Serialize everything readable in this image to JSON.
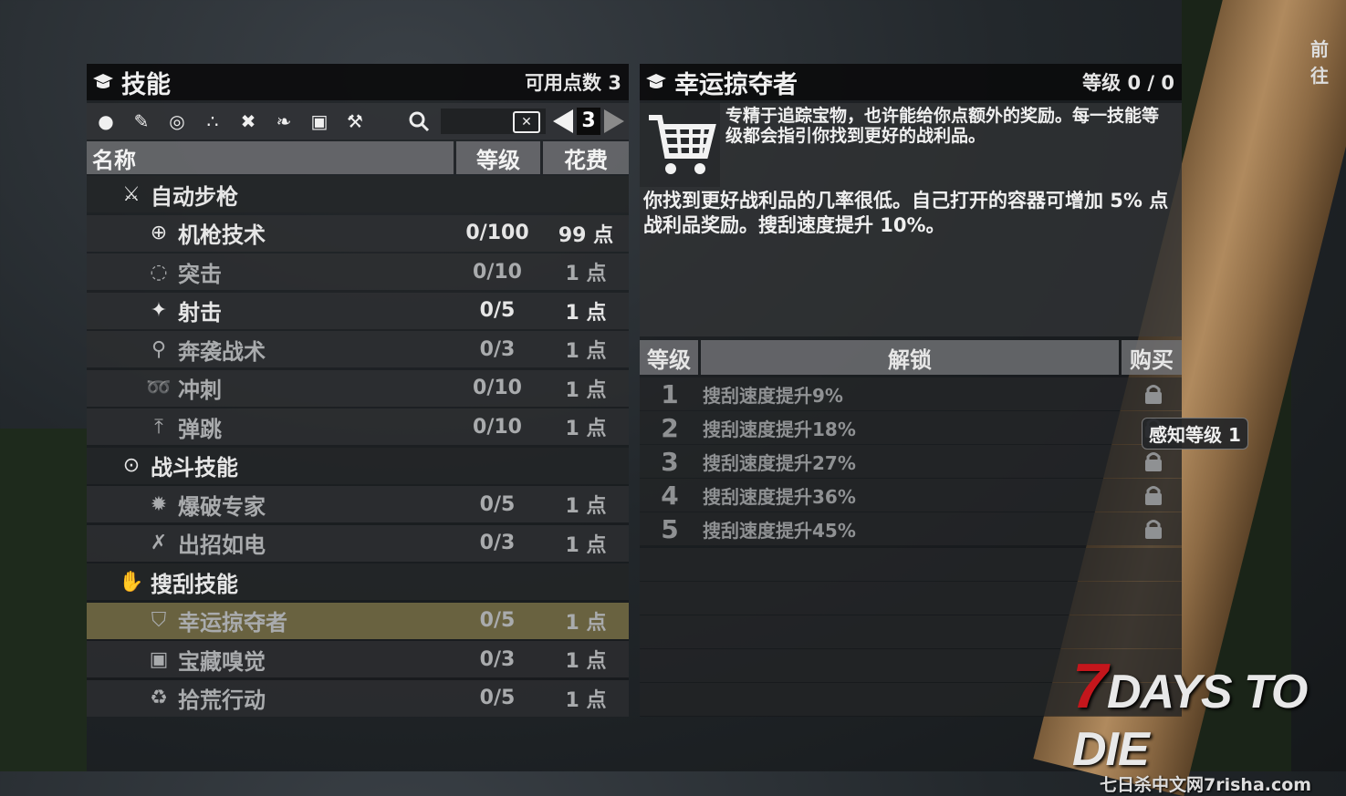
{
  "left_panel": {
    "title": "技能",
    "points_label": "可用点数 3"
  },
  "toolbar": {
    "page": "3",
    "icons": [
      "person-icon",
      "pen-icon",
      "target-icon",
      "stars-icon",
      "tools-icon",
      "feather-icon",
      "book-icon",
      "hammer-icon"
    ]
  },
  "columns": {
    "name": "名称",
    "level": "等级",
    "cost": "花费"
  },
  "rows": [
    {
      "type": "cat",
      "name": "自动步枪",
      "icon": "rifle-icon"
    },
    {
      "type": "skill",
      "name": "机枪技术",
      "level": "0/100",
      "cost": "99 点",
      "dim": false,
      "icon": "crosshair-icon"
    },
    {
      "type": "skill",
      "name": "突击",
      "level": "0/10",
      "cost": "1 点",
      "dim": true,
      "icon": "crosshair-outline-icon"
    },
    {
      "type": "skill",
      "name": "射击",
      "level": "0/5",
      "cost": "1 点",
      "dim": false,
      "icon": "shooter-icon"
    },
    {
      "type": "skill",
      "name": "奔袭战术",
      "level": "0/3",
      "cost": "1 点",
      "dim": true,
      "icon": "runner-icon"
    },
    {
      "type": "skill",
      "name": "冲刺",
      "level": "0/10",
      "cost": "1 点",
      "dim": true,
      "icon": "sprint-icon"
    },
    {
      "type": "skill",
      "name": "弹跳",
      "level": "0/10",
      "cost": "1 点",
      "dim": true,
      "icon": "jump-icon"
    },
    {
      "type": "cat",
      "name": "战斗技能",
      "icon": "combat-icon"
    },
    {
      "type": "skill",
      "name": "爆破专家",
      "level": "0/5",
      "cost": "1 点",
      "dim": true,
      "icon": "explosion-icon"
    },
    {
      "type": "skill",
      "name": "出招如电",
      "level": "0/3",
      "cost": "1 点",
      "dim": true,
      "icon": "crossed-swords-icon"
    },
    {
      "type": "cat",
      "name": "搜刮技能",
      "icon": "hand-icon"
    },
    {
      "type": "skill",
      "name": "幸运掠夺者",
      "level": "0/5",
      "cost": "1 点",
      "dim": true,
      "icon": "cart-icon",
      "selected": true
    },
    {
      "type": "skill",
      "name": "宝藏嗅觉",
      "level": "0/3",
      "cost": "1 点",
      "dim": true,
      "icon": "chest-icon"
    },
    {
      "type": "skill",
      "name": "拾荒行动",
      "level": "0/5",
      "cost": "1 点",
      "dim": true,
      "icon": "recycle-icon"
    }
  ],
  "right_panel": {
    "title": "幸运掠夺者",
    "level_label": "等级 0 / 0",
    "desc1": "专精于追踪宝物，也许能给你点额外的奖励。每一技能等级都会指引你找到更好的战利品。",
    "desc2": "你找到更好战利品的几率很低。自己打开的容器可增加 5% 点战利品奖励。搜刮速度提升 10%。"
  },
  "level_table": {
    "col_level": "等级",
    "col_unlock": "解锁",
    "col_buy": "购买",
    "rows": [
      {
        "n": "1",
        "text": "搜刮速度提升9%"
      },
      {
        "n": "2",
        "text": "搜刮速度提升18%"
      },
      {
        "n": "3",
        "text": "搜刮速度提升27%"
      },
      {
        "n": "4",
        "text": "搜刮速度提升36%"
      },
      {
        "n": "5",
        "text": "搜刮速度提升45%"
      }
    ]
  },
  "tooltip": "感知等级 1",
  "corner_text": "前往",
  "logo": {
    "main": "7 DAYS TO DIE",
    "sub": "七日杀中文网7risha.com"
  }
}
